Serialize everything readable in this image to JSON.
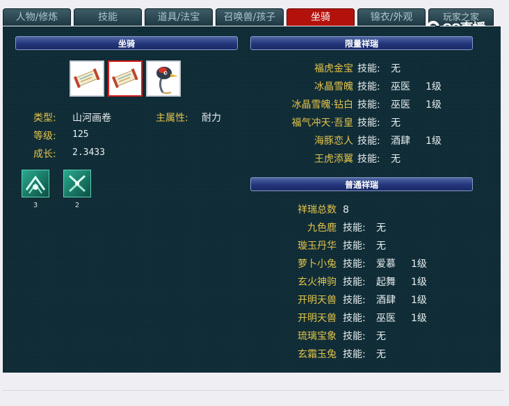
{
  "tabs": [
    {
      "label": "人物/修炼"
    },
    {
      "label": "技能"
    },
    {
      "label": "道具/法宝"
    },
    {
      "label": "召唤兽/孩子"
    },
    {
      "label": "坐骑"
    },
    {
      "label": "锦衣/外观"
    },
    {
      "label": "玩家之家"
    }
  ],
  "logo": {
    "text": "CC直播"
  },
  "left": {
    "header": "坐骑",
    "slots": [
      {
        "icon": "scroll-icon"
      },
      {
        "icon": "scroll-icon"
      },
      {
        "icon": "crane-bird-icon"
      }
    ],
    "type_label": "类型:",
    "type_value": "山河画卷",
    "attr_label": "主属性:",
    "attr_value": "耐力",
    "level_label": "等级:",
    "level_value": "125",
    "growth_label": "成长:",
    "growth_value": "2.3433",
    "skills": [
      {
        "icon": "mount-skill-icon",
        "count": "3"
      },
      {
        "icon": "mount-skill-icon",
        "count": "2"
      }
    ]
  },
  "limited": {
    "header": "限量祥瑞",
    "items": [
      {
        "name": "福虎金宝",
        "skill_label": "技能:",
        "skill": "无",
        "level": ""
      },
      {
        "name": "冰晶雪魄",
        "skill_label": "技能:",
        "skill": "巫医",
        "level": "1级"
      },
      {
        "name": "冰晶雪魄·钻白",
        "skill_label": "技能:",
        "skill": "巫医",
        "level": "1级"
      },
      {
        "name": "福气冲天·吾皇",
        "skill_label": "技能:",
        "skill": "无",
        "level": ""
      },
      {
        "name": "海豚恋人",
        "skill_label": "技能:",
        "skill": "酒肆",
        "level": "1级"
      },
      {
        "name": "王虎添翼",
        "skill_label": "技能:",
        "skill": "无",
        "level": ""
      }
    ]
  },
  "normal": {
    "header": "普通祥瑞",
    "total_label": "祥瑞总数",
    "total_value": "8",
    "items": [
      {
        "name": "九色鹿",
        "skill_label": "技能:",
        "skill": "无",
        "level": ""
      },
      {
        "name": "璇玉丹华",
        "skill_label": "技能:",
        "skill": "无",
        "level": ""
      },
      {
        "name": "萝卜小兔",
        "skill_label": "技能:",
        "skill": "爱慕",
        "level": "1级"
      },
      {
        "name": "玄火神驹",
        "skill_label": "技能:",
        "skill": "起舞",
        "level": "1级"
      },
      {
        "name": "开明天兽",
        "skill_label": "技能:",
        "skill": "酒肆",
        "level": "1级"
      },
      {
        "name": "开明天兽",
        "skill_label": "技能:",
        "skill": "巫医",
        "level": "1级"
      },
      {
        "name": "琉璃宝象",
        "skill_label": "技能:",
        "skill": "无",
        "level": ""
      },
      {
        "name": "玄霜玉兔",
        "skill_label": "技能:",
        "skill": "无",
        "level": ""
      }
    ]
  },
  "colors": {
    "active_tab": "#b3120c",
    "label_gold": "#e4c34a",
    "panel_bg": "#0d2a34",
    "header_bar": "#23357a"
  }
}
